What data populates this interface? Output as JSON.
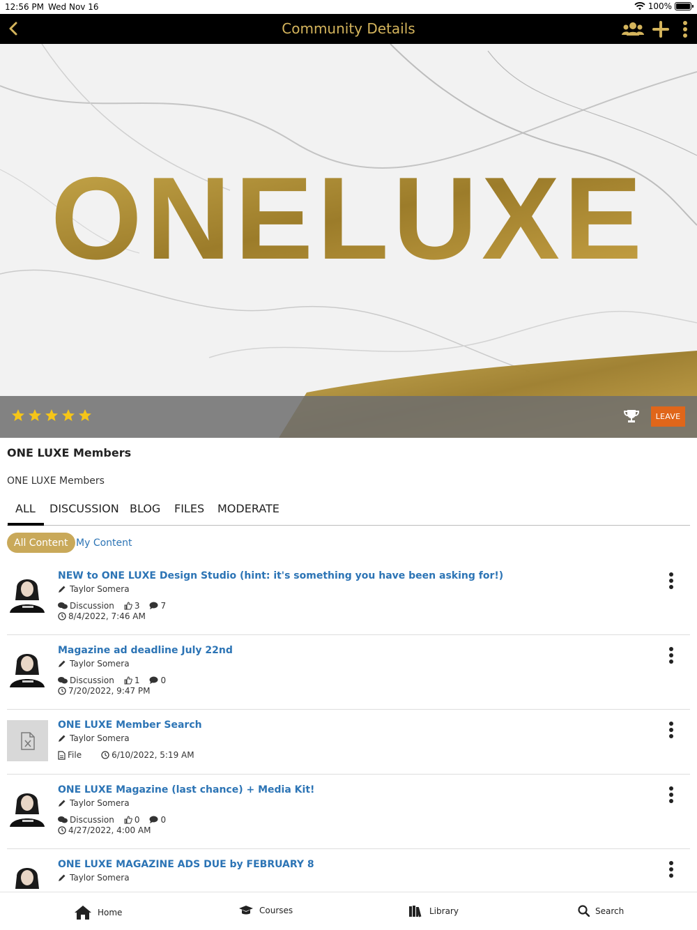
{
  "status_bar": {
    "time": "12:56 PM",
    "date": "Wed Nov 16",
    "battery": "100%"
  },
  "nav": {
    "title": "Community Details"
  },
  "hero": {
    "logo_text": "ONELUXE",
    "rating": 5,
    "leave_label": "LEAVE"
  },
  "community": {
    "name": "ONE LUXE Members",
    "description": "ONE LUXE Members"
  },
  "tabs": [
    "ALL",
    "DISCUSSION",
    "BLOG",
    "FILES",
    "MODERATE"
  ],
  "filters": {
    "all": "All Content",
    "mine": "My Content"
  },
  "feed": [
    {
      "title": "NEW to ONE LUXE Design Studio (hint: it's something you have been asking for!)",
      "author": "Taylor Somera",
      "type": "Discussion",
      "likes": "3",
      "comments": "7",
      "date": "8/4/2022, 7:46 AM"
    },
    {
      "title": "Magazine ad deadline July 22nd",
      "author": "Taylor Somera",
      "type": "Discussion",
      "likes": "1",
      "comments": "0",
      "date": "7/20/2022, 9:47 PM"
    },
    {
      "title": "ONE LUXE Member Search",
      "author": "Taylor Somera",
      "type": "File",
      "date": "6/10/2022, 5:19 AM"
    },
    {
      "title": "ONE LUXE Magazine (last chance) + Media Kit!",
      "author": "Taylor Somera",
      "type": "Discussion",
      "likes": "0",
      "comments": "0",
      "date": "4/27/2022, 4:00 AM"
    },
    {
      "title": "ONE LUXE MAGAZINE ADS DUE by FEBRUARY 8",
      "author": "Taylor Somera"
    }
  ],
  "bottom_tabs": {
    "home": "Home",
    "courses": "Courses",
    "library": "Library",
    "search": "Search"
  },
  "colors": {
    "gold": "#d4b45c",
    "link": "#2c74b5",
    "leave": "#e0661a",
    "filter_active": "#c9a95a",
    "star": "#f5c518"
  }
}
